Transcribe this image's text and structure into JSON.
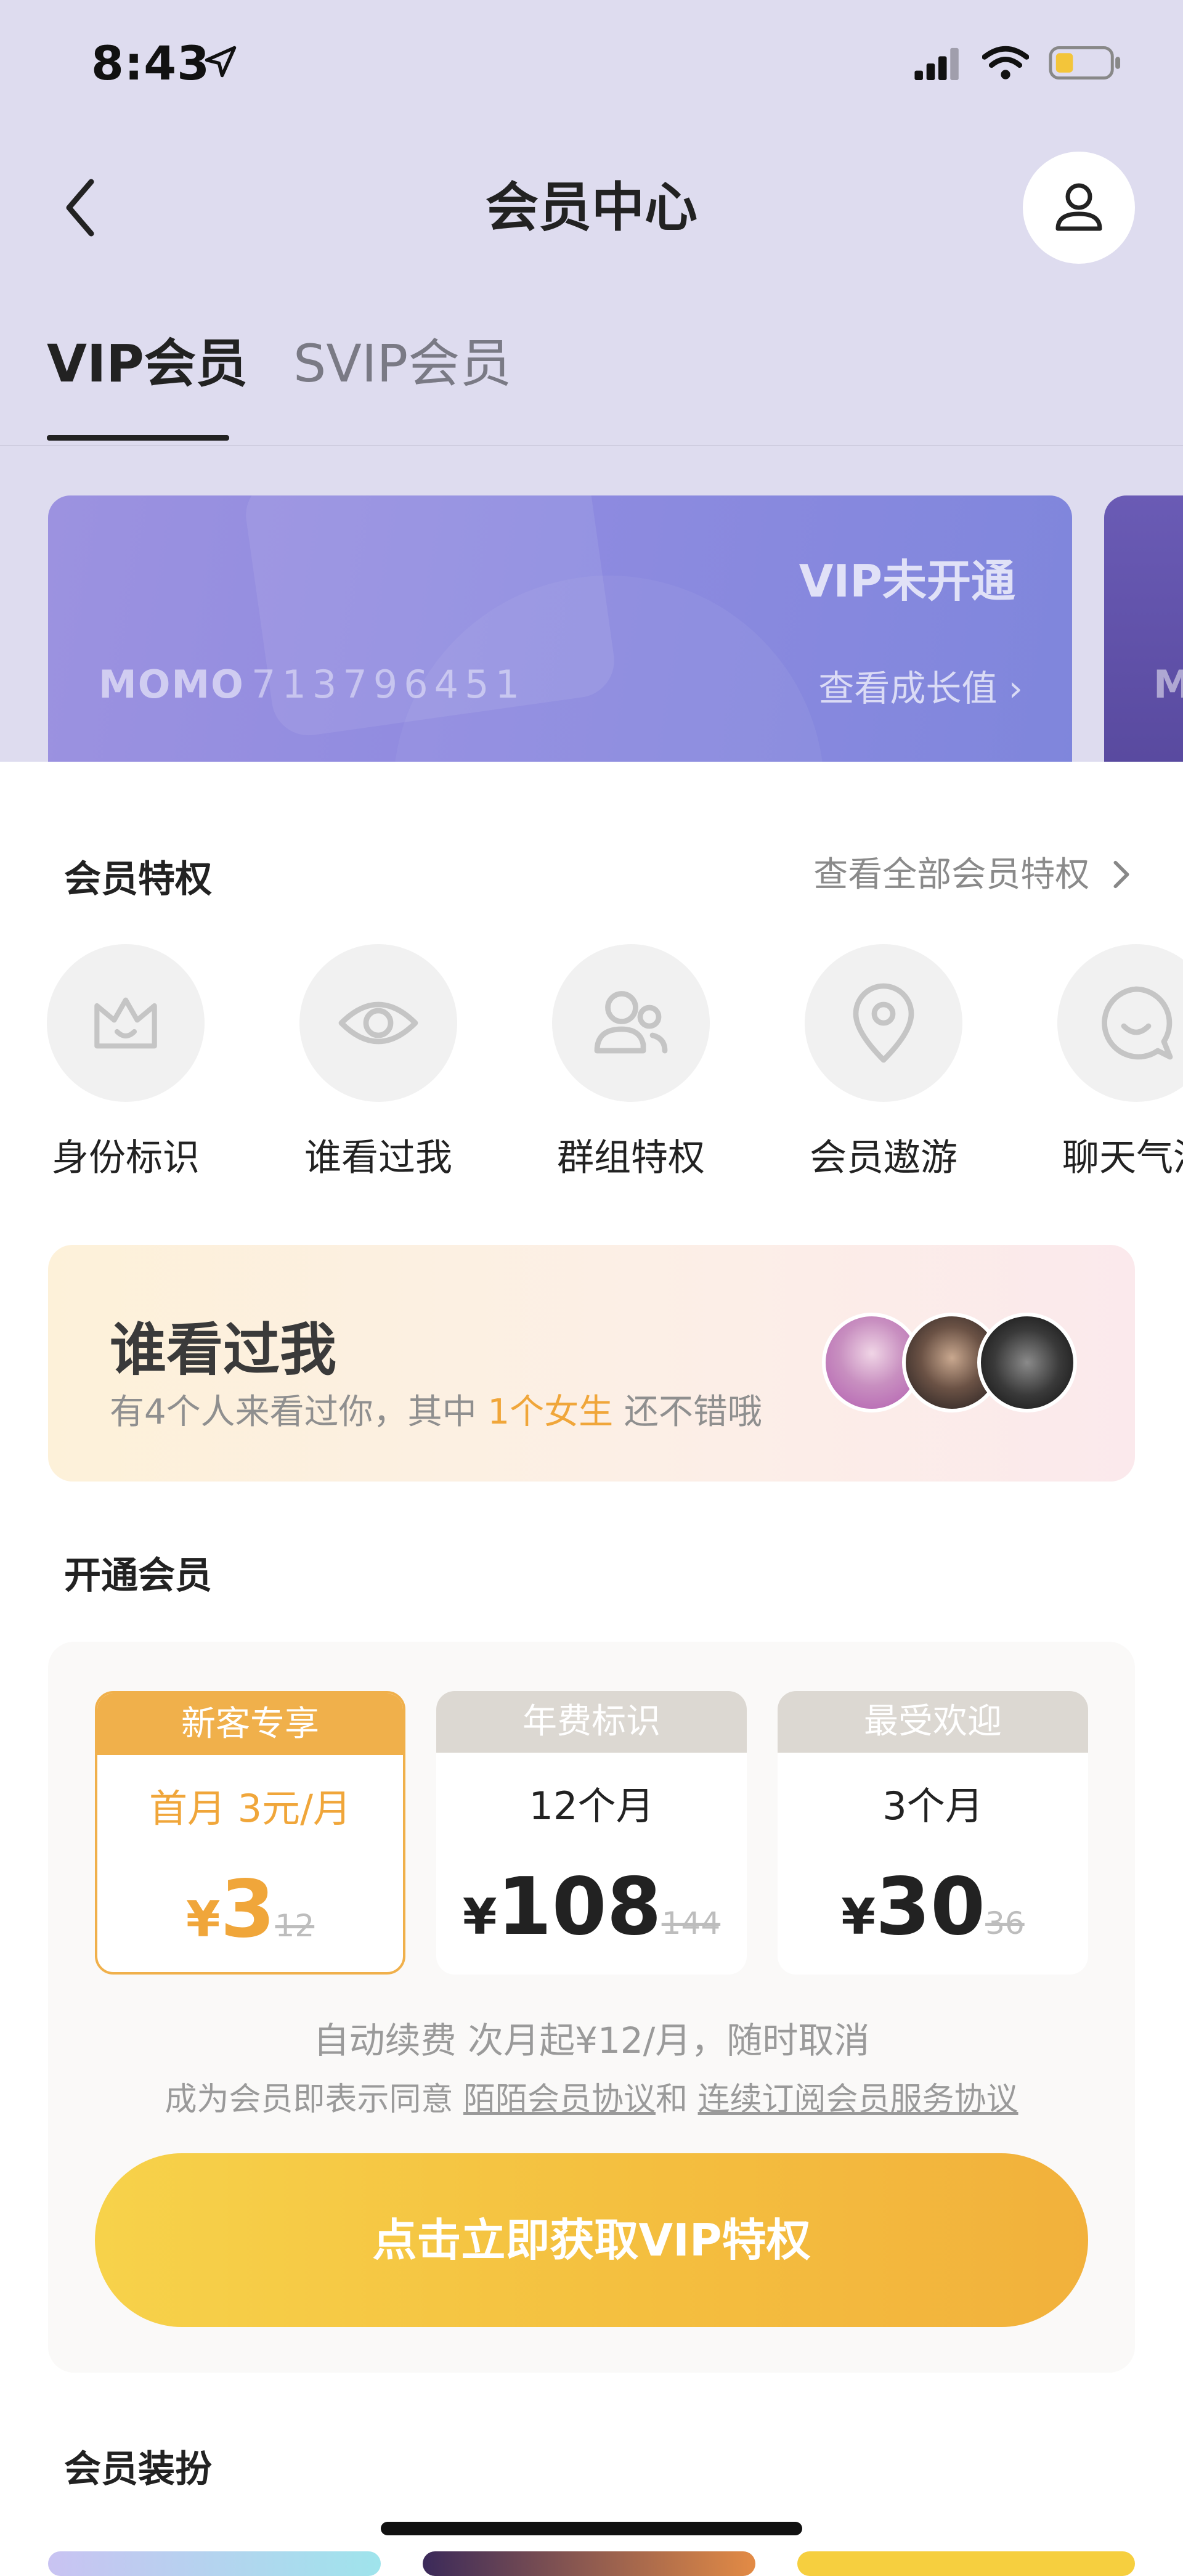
{
  "status_bar": {
    "time": "8:43"
  },
  "nav": {
    "title": "会员中心"
  },
  "tabs": [
    {
      "label": "VIP会员"
    },
    {
      "label": "SVIP会员"
    }
  ],
  "member_card": {
    "status": "VIP未开通",
    "brand": "MOMO",
    "member_id": "713796451",
    "growth_link": "查看成长值 ›",
    "next_card_brand": "M"
  },
  "privileges": {
    "title": "会员特权",
    "see_all": "查看全部会员特权",
    "items": [
      {
        "label": "身份标识",
        "icon": "crown-icon"
      },
      {
        "label": "谁看过我",
        "icon": "eye-icon"
      },
      {
        "label": "群组特权",
        "icon": "group-icon"
      },
      {
        "label": "会员遨游",
        "icon": "location-pin-icon"
      },
      {
        "label": "聊天气泡",
        "icon": "chat-bubble-icon"
      }
    ]
  },
  "visitors": {
    "title": "谁看过我",
    "desc_prefix": "有4个人来看过你，其中",
    "desc_highlight": "1个女生",
    "desc_suffix": "还不错哦",
    "highlight_color": "#f0a63a"
  },
  "open_membership": {
    "title": "开通会员",
    "plans": [
      {
        "tag": "新客专享",
        "tag_color": "#f0b04b",
        "name": "首月 3元/月",
        "currency": "¥",
        "price": "3",
        "original": "12",
        "selected": true
      },
      {
        "tag": "年费标识",
        "tag_color": "#dcd8d2",
        "name": "12个月",
        "currency": "¥",
        "price": "108",
        "original": "144",
        "selected": false
      },
      {
        "tag": "最受欢迎",
        "tag_color": "#dcd8d2",
        "name": "3个月",
        "currency": "¥",
        "price": "30",
        "original": "36",
        "selected": false
      }
    ],
    "renew_note": "自动续费 次月起¥12/月，随时取消",
    "agree_prefix": "成为会员即表示同意",
    "agreement1": "陌陌会员协议",
    "agree_and": "和",
    "agreement2": "连续订阅会员服务协议",
    "cta": "点击立即获取VIP特权"
  },
  "dress_up": {
    "title": "会员装扮"
  }
}
